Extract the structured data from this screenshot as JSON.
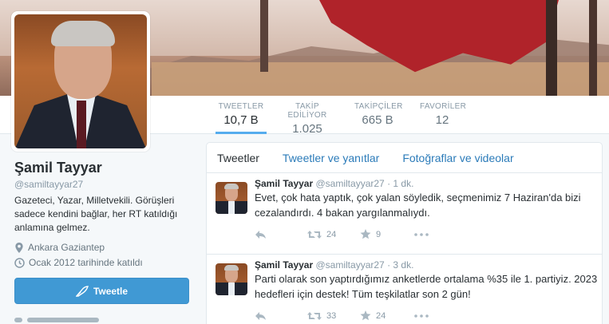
{
  "profile": {
    "name": "Şamil Tayyar",
    "handle": "@samiltayyar27",
    "bio": "Gazeteci, Yazar, Milletvekili. Görüşleri sadece kendini bağlar, her RT katıldığı anlamına gelmez.",
    "location": "Ankara Gaziantep",
    "joined": "Ocak 2012 tarihinde katıldı",
    "tweet_button": "Tweetle"
  },
  "stats": [
    {
      "label": "TWEETLER",
      "value": "10,7 B",
      "active": true
    },
    {
      "label": "TAKİP EDİLİYOR",
      "value": "1.025",
      "active": false
    },
    {
      "label": "TAKİPÇİLER",
      "value": "665 B",
      "active": false
    },
    {
      "label": "FAVORİLER",
      "value": "12",
      "active": false
    }
  ],
  "tabs": [
    "Tweetler",
    "Tweetler ve yanıtlar",
    "Fotoğraflar ve videolar"
  ],
  "tweets": [
    {
      "name": "Şamil Tayyar",
      "handle": "@samiltayyar27",
      "sep": "·",
      "time": "1 dk.",
      "text": "Evet, çok hata yaptık, çok yalan söyledik, seçmenimiz 7 Haziran'da bizi cezalandırdı. 4 bakan yargılanmalıydı.",
      "retweets": "24",
      "favorites": "9"
    },
    {
      "name": "Şamil Tayyar",
      "handle": "@samiltayyar27",
      "sep": "·",
      "time": "3 dk.",
      "text": "Parti olarak son yaptırdığımız anketlerde ortalama %35 ile 1. partiyiz. 2023 hedefleri için destek! Tüm teşkilatlar son 2 gün!",
      "retweets": "33",
      "favorites": "24"
    }
  ],
  "colors": {
    "accent": "#55acee",
    "link": "#2b7bb9",
    "button": "#4099d4",
    "banner_flag": "#b0232a"
  },
  "icons": [
    "location-pin-icon",
    "calendar-icon",
    "quill-icon",
    "reply-icon",
    "retweet-icon",
    "star-icon",
    "more-icon"
  ]
}
